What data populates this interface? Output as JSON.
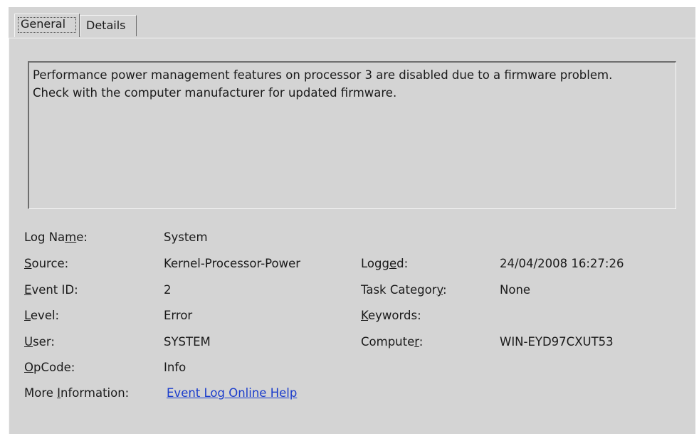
{
  "tabs": [
    {
      "label": "General",
      "active": true
    },
    {
      "label": "Details",
      "active": false
    }
  ],
  "description": "Performance power management features on processor 3 are disabled due to a firmware problem.\nCheck with the computer manufacturer for updated firmware.",
  "fields": {
    "log_name": {
      "label": "Log Name:",
      "value": "System"
    },
    "source": {
      "label": "Source:",
      "value": "Kernel-Processor-Power"
    },
    "event_id": {
      "label": "Event ID:",
      "value": "2"
    },
    "level": {
      "label": "Level:",
      "value": "Error"
    },
    "user": {
      "label": "User:",
      "value": "SYSTEM"
    },
    "opcode": {
      "label": "OpCode:",
      "value": "Info"
    },
    "more_info": {
      "label": "More Information:",
      "link": "Event Log Online Help"
    },
    "logged": {
      "label": "Logged:",
      "value": "24/04/2008 16:27:26"
    },
    "task_category": {
      "label": "Task Category:",
      "value": "None"
    },
    "keywords": {
      "label": "Keywords:",
      "value": ""
    },
    "computer": {
      "label": "Computer:",
      "value": "WIN-EYD97CXUT53"
    }
  },
  "colors": {
    "panel": "#d4d4d4",
    "link": "#1a3ccc"
  }
}
